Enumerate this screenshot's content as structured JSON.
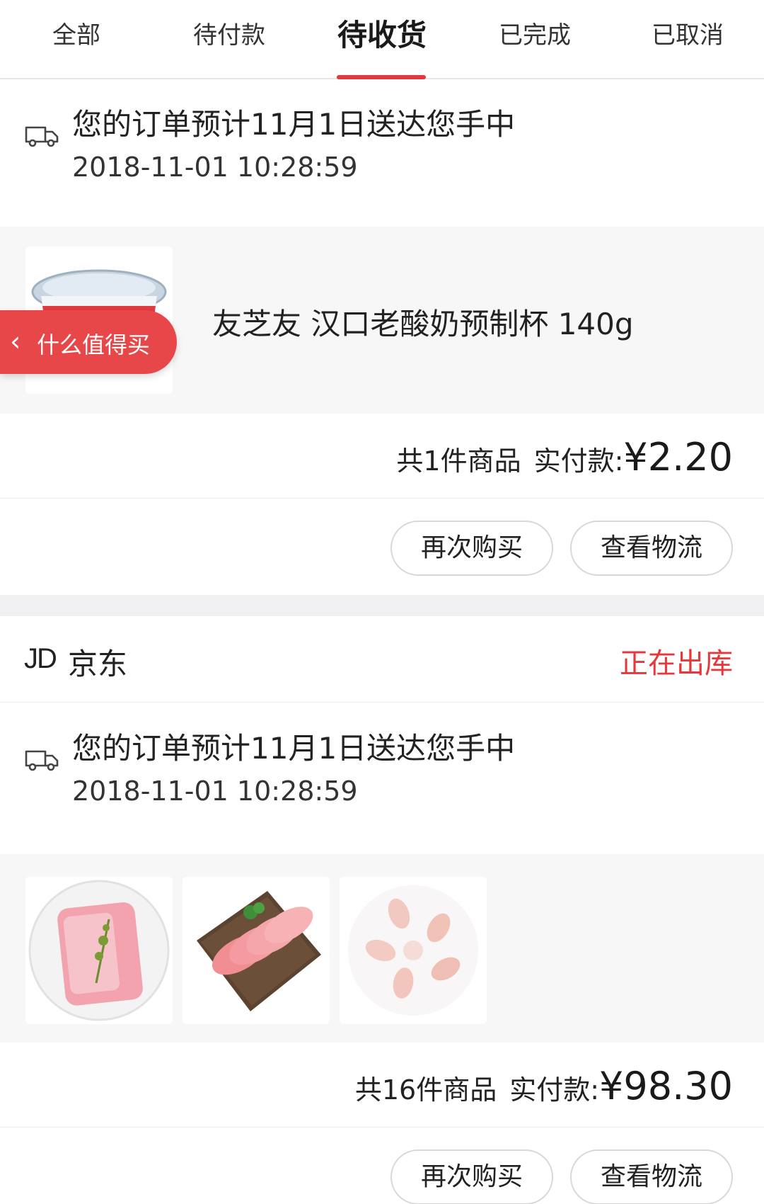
{
  "tabs": [
    {
      "label": "全部"
    },
    {
      "label": "待付款"
    },
    {
      "label": "待收货"
    },
    {
      "label": "已完成"
    },
    {
      "label": "已取消"
    }
  ],
  "active_tab": "待收货",
  "order1": {
    "delivery_text": "您的订单预计11月1日送达您手中",
    "delivery_time": "2018-11-01 10:28:59",
    "product_name": "友芝友 汉口老酸奶预制杯 140g",
    "item_count": "共1件商品",
    "paid_label": "实付款:",
    "paid_amount": "¥2.20",
    "buy_again": "再次购买",
    "view_logistics": "查看物流"
  },
  "order2": {
    "shop_logo": "JD",
    "shop_name": "京东",
    "status": "正在出库",
    "delivery_text": "您的订单预计11月1日送达您手中",
    "delivery_time": "2018-11-01 10:28:59",
    "item_count": "共16件商品",
    "paid_label": "实付款:",
    "paid_amount": "¥98.30",
    "buy_again": "再次购买",
    "view_logistics": "查看物流"
  },
  "floating_pill": {
    "label": "什么值得买",
    "icon": "chevron-left-icon"
  },
  "colors": {
    "accent": "#e4393c",
    "pill": "#e8474a",
    "product_bg": "#f7f7f8"
  }
}
